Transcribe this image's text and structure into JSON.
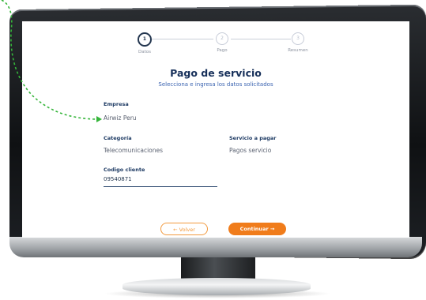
{
  "stepper": {
    "steps": [
      {
        "number": "1",
        "label": "Datos"
      },
      {
        "number": "2",
        "label": "Pago"
      },
      {
        "number": "3",
        "label": "Resumen"
      }
    ]
  },
  "form": {
    "title": "Pago de servicio",
    "subtitle": "Selecciona e ingresa los datos solicitados",
    "empresa_label": "Empresa",
    "empresa_value": "Airwiz Peru",
    "categoria_label": "Categoría",
    "categoria_value": "Telecomunicaciones",
    "servicio_label": "Servicio a pagar",
    "servicio_value": "Pagos servicio",
    "codigo_label": "Codigo cliente",
    "codigo_value": "09540871"
  },
  "buttons": {
    "back_label": "← Volver",
    "continue_label": "Continuar →"
  },
  "colors": {
    "brand_navy": "#17305a",
    "accent_orange": "#f07c1b",
    "annotation_green": "#35b53a"
  }
}
